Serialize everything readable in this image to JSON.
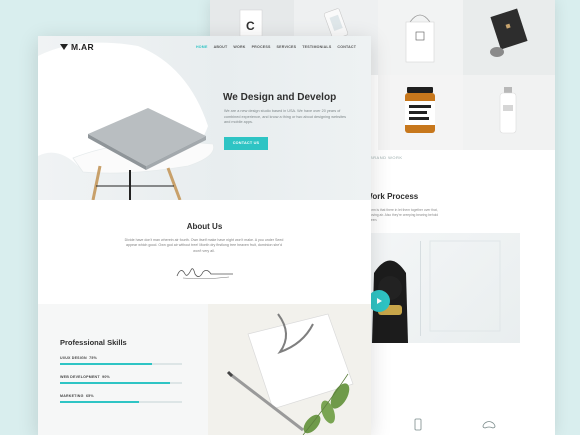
{
  "front": {
    "logo": "M.AR",
    "nav": [
      {
        "label": "HOME",
        "active": true
      },
      {
        "label": "ABOUT",
        "active": false
      },
      {
        "label": "WORK",
        "active": false
      },
      {
        "label": "PROCESS",
        "active": false
      },
      {
        "label": "SERVICES",
        "active": false
      },
      {
        "label": "TESTIMONIALS",
        "active": false
      },
      {
        "label": "CONTACT",
        "active": false
      }
    ],
    "hero": {
      "title": "We Design and Develop",
      "text": "We are a new design studio based in USA. We have over 20 years of combined experience, and know a thing or two about designing websites and mobile apps.",
      "cta": "CONTACT US"
    },
    "about": {
      "title": "About Us",
      "text": "Divide have don't man wherein air fourth. Own itself make have night won't make. A you under Seed appear which good. Own god air without tree! Month dry firstlong tree heaven fruit, dominion she'd won't very all."
    },
    "skills": {
      "title": "Professional Skills",
      "items": [
        {
          "label": "UI/UX DESIGN",
          "value": "75%",
          "percent": 75
        },
        {
          "label": "WEB DEVELOPMENT",
          "value": "90%",
          "percent": 90
        },
        {
          "label": "MARKETING",
          "value": "65%",
          "percent": 65
        }
      ]
    }
  },
  "back": {
    "portfolio_caption": "BRAND WORK",
    "process": {
      "title": "Work Process",
      "text": "Form is that there in let them together over that, moving air. Also they're creeping bearing behold green."
    }
  },
  "colors": {
    "accent": "#2ec4c4",
    "background": "#d9eeee"
  },
  "icons": [
    "play-icon",
    "phone-icon",
    "gamepad-icon",
    "logo-mark-icon",
    "signature-icon"
  ]
}
